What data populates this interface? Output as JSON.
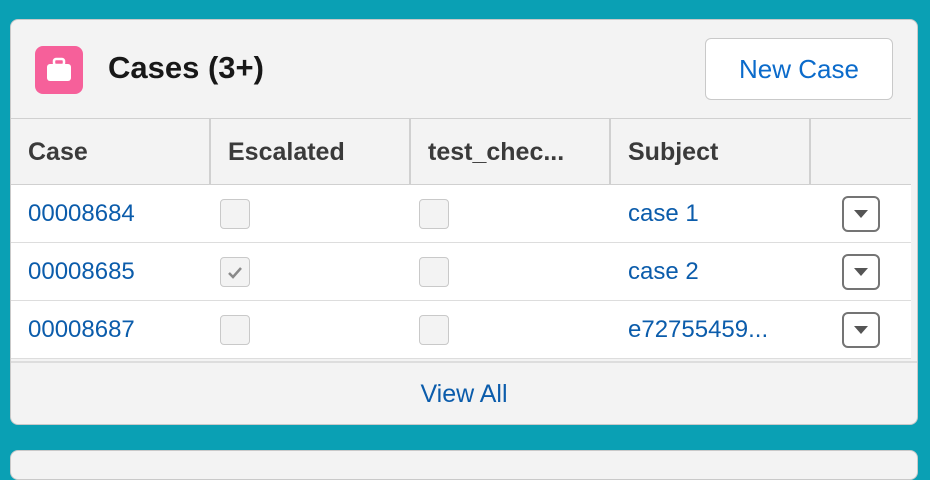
{
  "card": {
    "title": "Cases (3+)",
    "icon": "briefcase-icon",
    "new_button_label": "New Case",
    "view_all_label": "View All"
  },
  "table": {
    "columns": [
      "Case",
      "Escalated",
      "test_chec...",
      "Subject"
    ],
    "rows": [
      {
        "case": "00008684",
        "escalated": false,
        "test_checkbox": false,
        "subject": "case 1"
      },
      {
        "case": "00008685",
        "escalated": true,
        "test_checkbox": false,
        "subject": "case 2"
      },
      {
        "case": "00008687",
        "escalated": false,
        "test_checkbox": false,
        "subject": "e72755459..."
      }
    ]
  },
  "colors": {
    "page_background": "#0aa0b4",
    "icon_background": "#f6609a",
    "link": "#0b5cab"
  }
}
